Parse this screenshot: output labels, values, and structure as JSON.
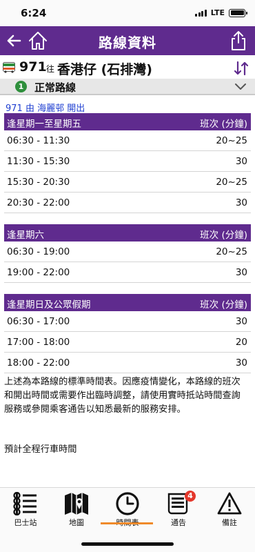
{
  "status": {
    "time": "6:24",
    "network": "LTE"
  },
  "nav": {
    "title": "路線資料"
  },
  "route": {
    "number": "971",
    "to_label": "往",
    "destination": "香港仔 (石排灣)"
  },
  "variant": {
    "number": "1",
    "label": "正常路線"
  },
  "departure": "971 由 海麗邨 開出",
  "sections": [
    {
      "title": "逢星期一至星期五",
      "freq_header": "班次 (分鐘)",
      "rows": [
        {
          "time": "06:30 - 11:30",
          "freq": "20~25"
        },
        {
          "time": "11:30 - 15:30",
          "freq": "30"
        },
        {
          "time": "15:30 - 20:30",
          "freq": "20~25"
        },
        {
          "time": "20:30 - 22:00",
          "freq": "30"
        }
      ]
    },
    {
      "title": "逢星期六",
      "freq_header": "班次 (分鐘)",
      "rows": [
        {
          "time": "06:30 - 19:00",
          "freq": "20~25"
        },
        {
          "time": "19:00 - 22:00",
          "freq": "30"
        }
      ]
    },
    {
      "title": "逢星期日及公眾假期",
      "freq_header": "班次 (分鐘)",
      "rows": [
        {
          "time": "06:30 - 17:00",
          "freq": "30"
        },
        {
          "time": "17:00 - 18:00",
          "freq": "20"
        },
        {
          "time": "18:00 - 22:00",
          "freq": "30"
        }
      ]
    }
  ],
  "note": "上述為本路線的標準時間表。因應疫情變化，本路線的班次和開出時間或需要作出臨時調整，請使用實時抵站時間查詢服務或參閱乘客通告以知悉最新的服務安排。",
  "note2": "預計全程行車時間",
  "tabs": [
    {
      "label": "巴士站",
      "icon": "bus-stop-list-icon"
    },
    {
      "label": "地圖",
      "icon": "map-icon"
    },
    {
      "label": "時間表",
      "icon": "clock-icon"
    },
    {
      "label": "通告",
      "icon": "notice-icon"
    },
    {
      "label": "備註",
      "icon": "warning-icon"
    }
  ],
  "notice_badge": "4",
  "active_tab": "時間表",
  "colors": {
    "primary": "#5f2b8e",
    "accent": "#f08a2a",
    "link": "#1f3fd1",
    "variant_badge": "#2e8f3c",
    "badge": "#e4372b"
  }
}
